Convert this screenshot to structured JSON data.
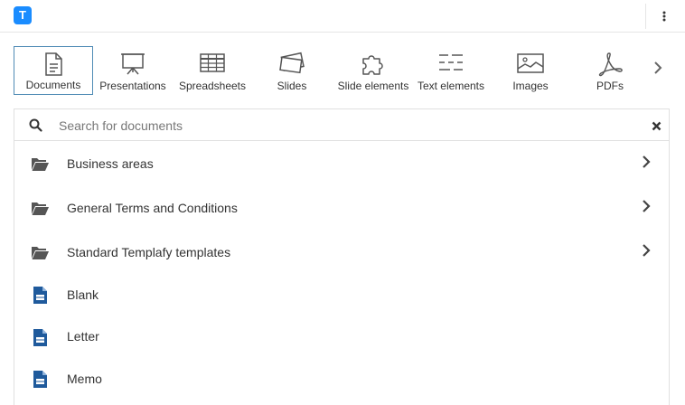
{
  "app": {
    "logo_letter": "T"
  },
  "categories": [
    {
      "label": "Documents",
      "icon": "document-icon",
      "active": true
    },
    {
      "label": "Presentations",
      "icon": "presentation-board-icon",
      "active": false
    },
    {
      "label": "Spreadsheets",
      "icon": "spreadsheet-grid-icon",
      "active": false
    },
    {
      "label": "Slides",
      "icon": "slides-stack-icon",
      "active": false
    },
    {
      "label": "Slide elements",
      "icon": "puzzle-piece-icon",
      "active": false
    },
    {
      "label": "Text elements",
      "icon": "text-lines-icon",
      "active": false
    },
    {
      "label": "Images",
      "icon": "image-icon",
      "active": false
    },
    {
      "label": "PDFs",
      "icon": "pdf-icon",
      "active": false
    }
  ],
  "search": {
    "placeholder": "Search for documents",
    "value": ""
  },
  "items": [
    {
      "label": "Business areas",
      "type": "folder"
    },
    {
      "label": "General Terms and Conditions",
      "type": "folder"
    },
    {
      "label": "Standard Templafy templates",
      "type": "folder"
    },
    {
      "label": "Blank",
      "type": "document"
    },
    {
      "label": "Letter",
      "type": "document"
    },
    {
      "label": "Memo",
      "type": "document"
    }
  ],
  "colors": {
    "accent": "#1a8cff",
    "doc_icon": "#1f5a9c",
    "active_border": "#4f8bb5",
    "icon_gray": "#555555"
  }
}
